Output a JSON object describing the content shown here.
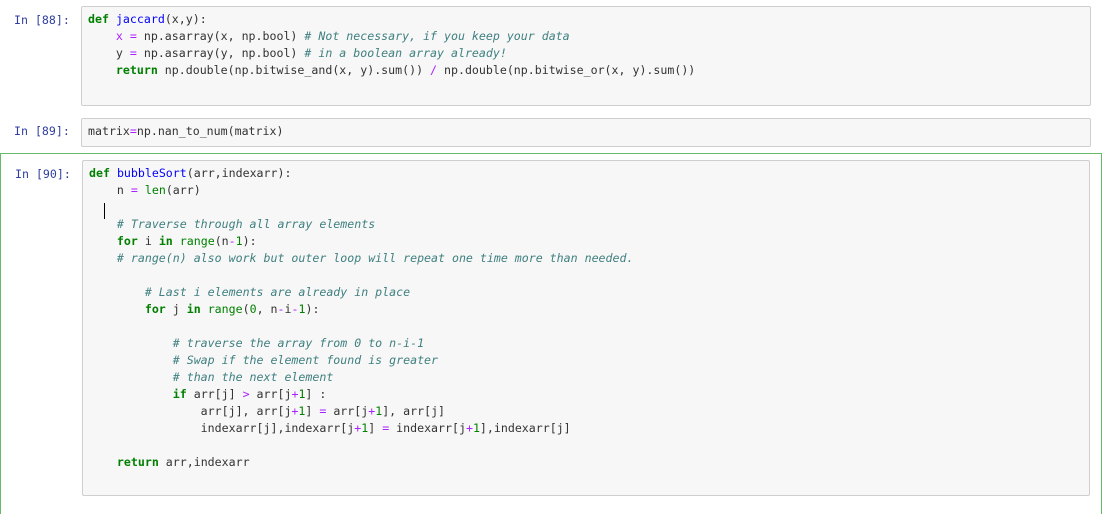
{
  "cells": [
    {
      "prompt": "In [88]:",
      "lines": [
        [
          {
            "t": "def",
            "c": "kw"
          },
          {
            "t": " "
          },
          {
            "t": "jaccard",
            "c": "fn"
          },
          {
            "t": "(x,y):"
          }
        ],
        [
          {
            "t": "    "
          },
          {
            "t": "x",
            "c": "op"
          },
          {
            "t": " "
          },
          {
            "t": "=",
            "c": "op"
          },
          {
            "t": " np.asarray(x, np.bool) "
          },
          {
            "t": "# Not necessary, if you keep your data",
            "c": "cm"
          }
        ],
        [
          {
            "t": "    y "
          },
          {
            "t": "=",
            "c": "op"
          },
          {
            "t": " np.asarray(y, np.bool) "
          },
          {
            "t": "# in a boolean array already!",
            "c": "cm"
          }
        ],
        [
          {
            "t": "    "
          },
          {
            "t": "return",
            "c": "kw"
          },
          {
            "t": " np.double(np.bitwise_and(x, y).sum()) "
          },
          {
            "t": "/",
            "c": "op"
          },
          {
            "t": " np.double(np.bitwise_or(x, y).sum())"
          }
        ]
      ]
    },
    {
      "prompt": "In [89]:",
      "lines": [
        [
          {
            "t": "matrix"
          },
          {
            "t": "=",
            "c": "op"
          },
          {
            "t": "np.nan_to_num(matrix)"
          }
        ]
      ]
    },
    {
      "prompt": "In [90]:",
      "lines": [
        [
          {
            "t": "def",
            "c": "kw"
          },
          {
            "t": " "
          },
          {
            "t": "bubbleSort",
            "c": "fn"
          },
          {
            "t": "(arr,indexarr):"
          }
        ],
        [
          {
            "t": "    n "
          },
          {
            "t": "=",
            "c": "op"
          },
          {
            "t": " "
          },
          {
            "t": "len",
            "c": "num"
          },
          {
            "t": "(arr)"
          }
        ],
        [
          {
            "t": ""
          }
        ],
        [
          {
            "t": "    "
          },
          {
            "t": "# Traverse through all array elements",
            "c": "cm"
          }
        ],
        [
          {
            "t": "    "
          },
          {
            "t": "for",
            "c": "kw"
          },
          {
            "t": " i "
          },
          {
            "t": "in",
            "c": "kw"
          },
          {
            "t": " "
          },
          {
            "t": "range",
            "c": "num"
          },
          {
            "t": "(n"
          },
          {
            "t": "-",
            "c": "op"
          },
          {
            "t": "1",
            "c": "num"
          },
          {
            "t": "):"
          }
        ],
        [
          {
            "t": "    "
          },
          {
            "t": "# range(n) also work but outer loop will repeat one time more than needed.",
            "c": "cm"
          }
        ],
        [
          {
            "t": ""
          }
        ],
        [
          {
            "t": "        "
          },
          {
            "t": "# Last i elements are already in place",
            "c": "cm"
          }
        ],
        [
          {
            "t": "        "
          },
          {
            "t": "for",
            "c": "kw"
          },
          {
            "t": " j "
          },
          {
            "t": "in",
            "c": "kw"
          },
          {
            "t": " "
          },
          {
            "t": "range",
            "c": "num"
          },
          {
            "t": "("
          },
          {
            "t": "0",
            "c": "num"
          },
          {
            "t": ", n"
          },
          {
            "t": "-",
            "c": "op"
          },
          {
            "t": "i"
          },
          {
            "t": "-",
            "c": "op"
          },
          {
            "t": "1",
            "c": "num"
          },
          {
            "t": "):"
          }
        ],
        [
          {
            "t": ""
          }
        ],
        [
          {
            "t": "            "
          },
          {
            "t": "# traverse the array from 0 to n-i-1",
            "c": "cm"
          }
        ],
        [
          {
            "t": "            "
          },
          {
            "t": "# Swap if the element found is greater",
            "c": "cm"
          }
        ],
        [
          {
            "t": "            "
          },
          {
            "t": "# than the next element",
            "c": "cm"
          }
        ],
        [
          {
            "t": "            "
          },
          {
            "t": "if",
            "c": "kw"
          },
          {
            "t": " arr[j] "
          },
          {
            "t": ">",
            "c": "op"
          },
          {
            "t": " arr[j"
          },
          {
            "t": "+",
            "c": "op"
          },
          {
            "t": "1",
            "c": "num"
          },
          {
            "t": "] :"
          }
        ],
        [
          {
            "t": "                arr[j], arr[j"
          },
          {
            "t": "+",
            "c": "op"
          },
          {
            "t": "1",
            "c": "num"
          },
          {
            "t": "] "
          },
          {
            "t": "=",
            "c": "op"
          },
          {
            "t": " arr[j"
          },
          {
            "t": "+",
            "c": "op"
          },
          {
            "t": "1",
            "c": "num"
          },
          {
            "t": "], arr[j]"
          }
        ],
        [
          {
            "t": "                indexarr[j],indexarr[j"
          },
          {
            "t": "+",
            "c": "op"
          },
          {
            "t": "1",
            "c": "num"
          },
          {
            "t": "] "
          },
          {
            "t": "=",
            "c": "op"
          },
          {
            "t": " indexarr[j"
          },
          {
            "t": "+",
            "c": "op"
          },
          {
            "t": "1",
            "c": "num"
          },
          {
            "t": "],indexarr[j]"
          }
        ],
        [
          {
            "t": ""
          }
        ],
        [
          {
            "t": "    "
          },
          {
            "t": "return",
            "c": "kw"
          },
          {
            "t": " arr,indexarr"
          }
        ]
      ]
    }
  ]
}
